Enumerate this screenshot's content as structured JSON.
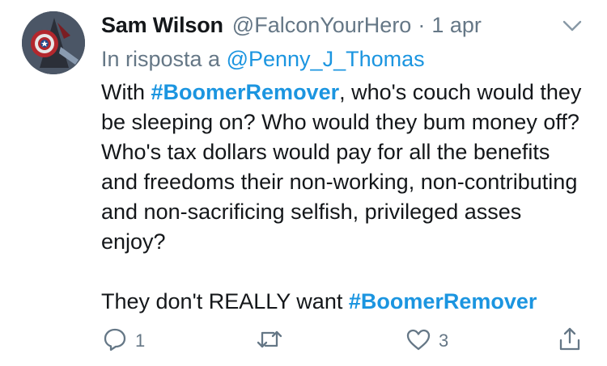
{
  "tweet": {
    "author_name": "Sam Wilson",
    "author_handle": "@FalconYourHero",
    "separator": "·",
    "date": "1 apr",
    "reply_prefix": "In risposta a",
    "reply_mention": "@Penny_J_Thomas",
    "p1_before": "With ",
    "p1_hashtag": "#BoomerRemover",
    "p1_after": ", who's couch would they be sleeping on? Who would they bum money off? Who's tax dollars would pay for all the benefits and freedoms their non-working, non-contributing and non-sacrificing selfish, privileged asses enjoy?",
    "p2_before": "They don't REALLY want ",
    "p2_hashtag": "#BoomerRemover"
  },
  "actions": {
    "reply_icon": "reply-icon",
    "reply_count": "1",
    "retweet_icon": "retweet-icon",
    "like_icon": "heart-icon",
    "like_count": "3",
    "share_icon": "share-icon"
  },
  "colors": {
    "link": "#1b95e0",
    "secondary_text": "#657786",
    "primary_text": "#14171a"
  }
}
